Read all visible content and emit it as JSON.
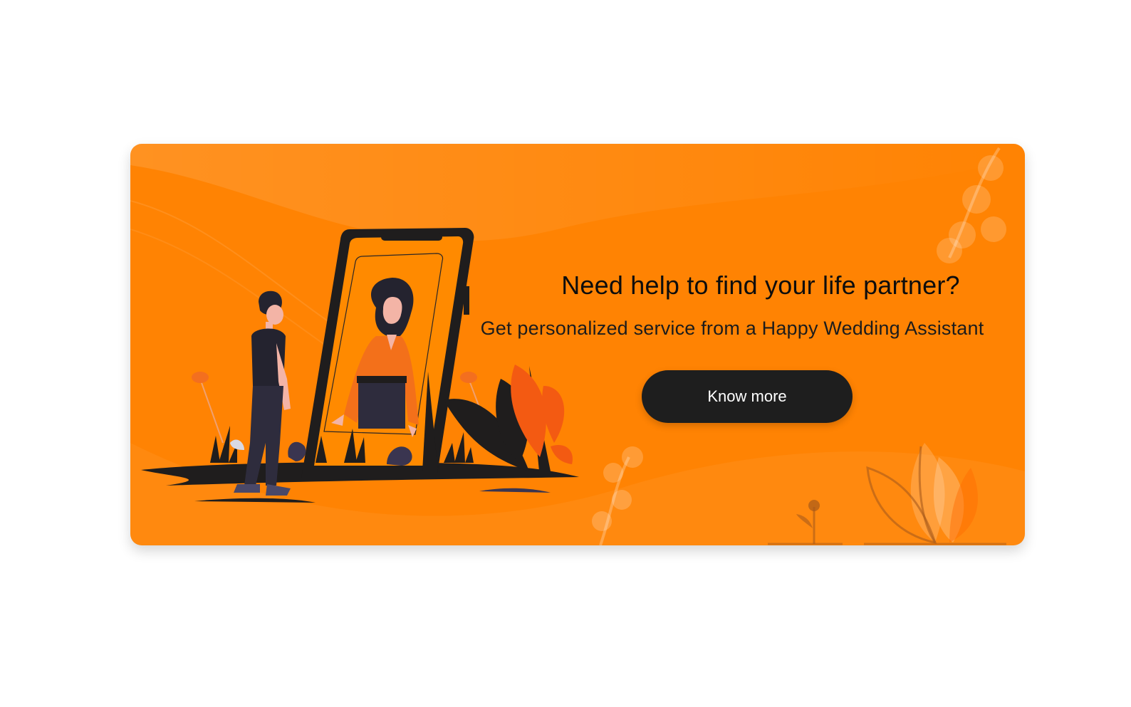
{
  "banner": {
    "headline": "Need help to find your life partner?",
    "subline": "Get personalized service from a Happy Wedding Assistant",
    "cta_label": "Know more",
    "background_color": "#ff8303",
    "button_color": "#1e1e1e"
  },
  "illustration": {
    "description_icon": "couple-phone-illustration-icon",
    "decor_icons": [
      "leaf-sprig-icon",
      "plant-icon",
      "flower-icon"
    ]
  }
}
